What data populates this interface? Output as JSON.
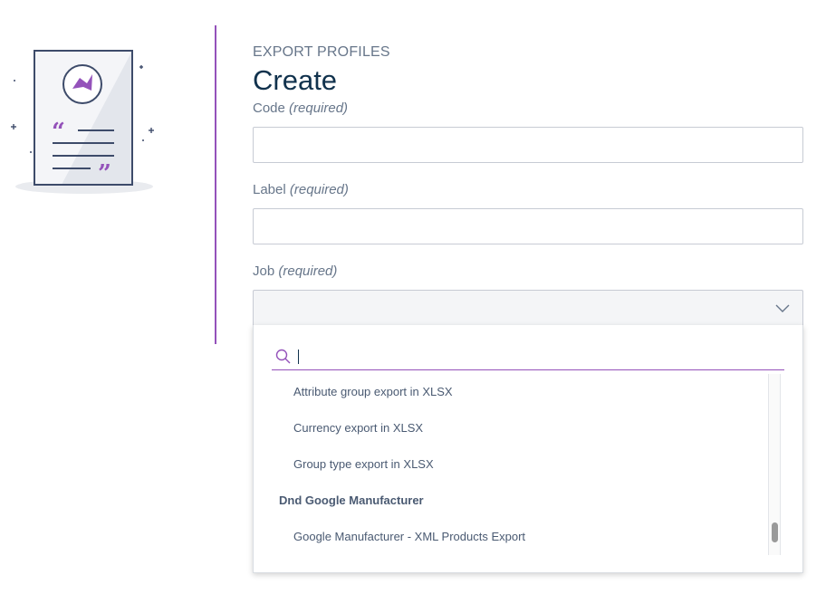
{
  "header": {
    "eyebrow": "EXPORT PROFILES",
    "title": "Create"
  },
  "form": {
    "code": {
      "label": "Code",
      "required": "(required)",
      "value": ""
    },
    "label": {
      "label": "Label",
      "required": "(required)",
      "value": ""
    },
    "job": {
      "label": "Job",
      "required": "(required)",
      "selected": ""
    }
  },
  "dropdown": {
    "search_value": "",
    "options": [
      {
        "type": "option",
        "text": "Attribute group export in XLSX"
      },
      {
        "type": "option",
        "text": "Currency export in XLSX"
      },
      {
        "type": "option",
        "text": "Group type export in XLSX"
      },
      {
        "type": "group",
        "text": "Dnd Google Manufacturer"
      },
      {
        "type": "option",
        "text": "Google Manufacturer - XML Products Export"
      }
    ],
    "scroll_position": 0.93
  },
  "colors": {
    "accent": "#9452ba",
    "title": "#11324d",
    "text": "#67768a",
    "border": "#c7cbd4"
  },
  "icons": {
    "illustration": "document-quote-illustration",
    "search": "search-icon",
    "chevron": "chevron-down-icon"
  }
}
